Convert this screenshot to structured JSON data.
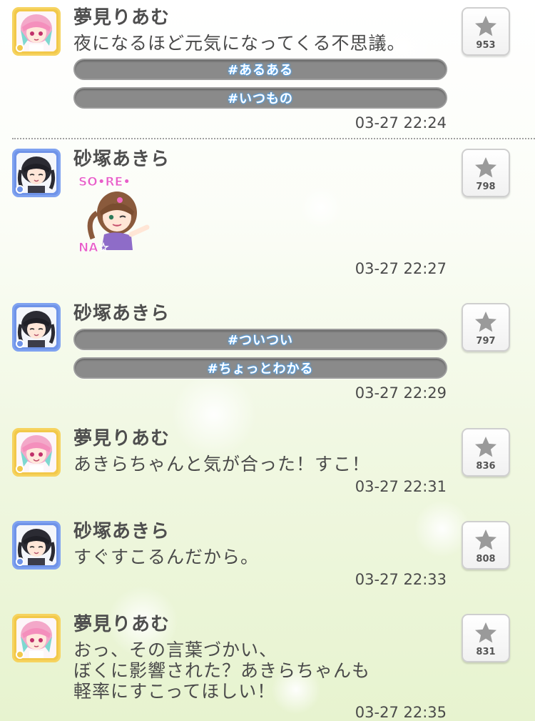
{
  "messages": [
    {
      "sender": "夢見りあむ",
      "avatar": "riamu-avatar",
      "text": "夜になるほど元気になってくる不思議。",
      "tags": [
        "#あるある",
        "#いつもの"
      ],
      "time": "03-27 22:24",
      "likes": "953"
    },
    {
      "sender": "砂塚あきら",
      "avatar": "akira-avatar",
      "stamp": {
        "line1": "SO•RE•",
        "line2": "NA☆"
      },
      "time": "03-27 22:27",
      "likes": "798"
    },
    {
      "sender": "砂塚あきら",
      "avatar": "akira-avatar",
      "tags": [
        "#ついつい",
        "#ちょっとわかる"
      ],
      "time": "03-27 22:29",
      "likes": "797"
    },
    {
      "sender": "夢見りあむ",
      "avatar": "riamu-avatar",
      "text": "あきらちゃんと気が合った！すこ！",
      "time": "03-27 22:31",
      "likes": "836"
    },
    {
      "sender": "砂塚あきら",
      "avatar": "akira-avatar",
      "text": "すぐすこるんだから。",
      "time": "03-27 22:33",
      "likes": "808"
    },
    {
      "sender": "夢見りあむ",
      "avatar": "riamu-avatar",
      "text": "おっ、その言葉づかい、\nぼくに影響された？あきらちゃんも\n軽率にすこってほしい！",
      "time": "03-27 22:35",
      "likes": "831"
    }
  ],
  "colors": {
    "riamu_frame": "#f2c84a",
    "akira_frame": "#6f93e8",
    "tag_bg": "#8a8a8a",
    "tag_glow": "#4aa9ff",
    "star_icon": "#9a9a9a",
    "stamp_text": "#e85fc8"
  },
  "icons": {
    "like": "star-icon"
  }
}
